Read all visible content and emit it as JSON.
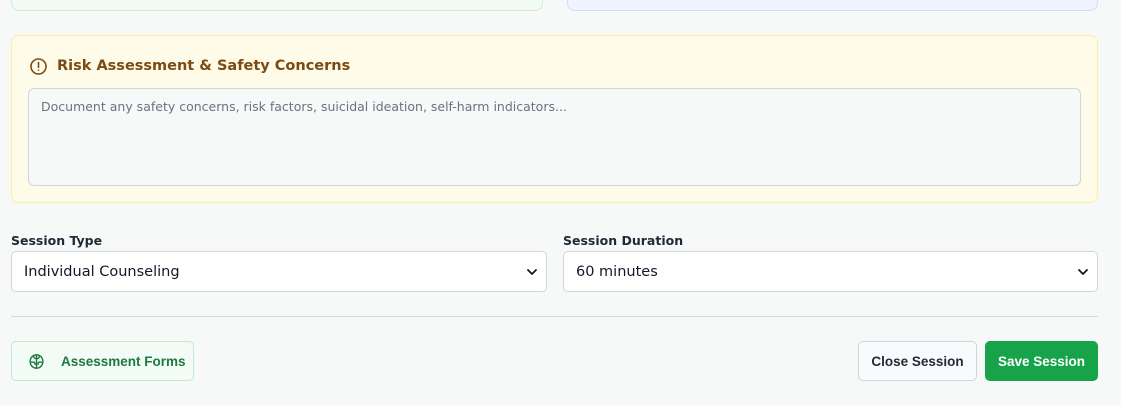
{
  "risk_assessment": {
    "title": "Risk Assessment & Safety Concerns",
    "icon": "alert-circle-icon",
    "placeholder": "Document any safety concerns, risk factors, suicidal ideation, self-harm indicators...",
    "value": ""
  },
  "session_type": {
    "label": "Session Type",
    "selected": "Individual Counseling"
  },
  "session_duration": {
    "label": "Session Duration",
    "selected": "60 minutes"
  },
  "footer": {
    "assessment_forms_label": "Assessment Forms",
    "assessment_forms_icon": "brain-icon",
    "close_label": "Close Session",
    "save_label": "Save Session"
  },
  "colors": {
    "accent_green": "#16a34a",
    "warning_bg": "#fefce8",
    "warning_text": "#7c4a12"
  }
}
